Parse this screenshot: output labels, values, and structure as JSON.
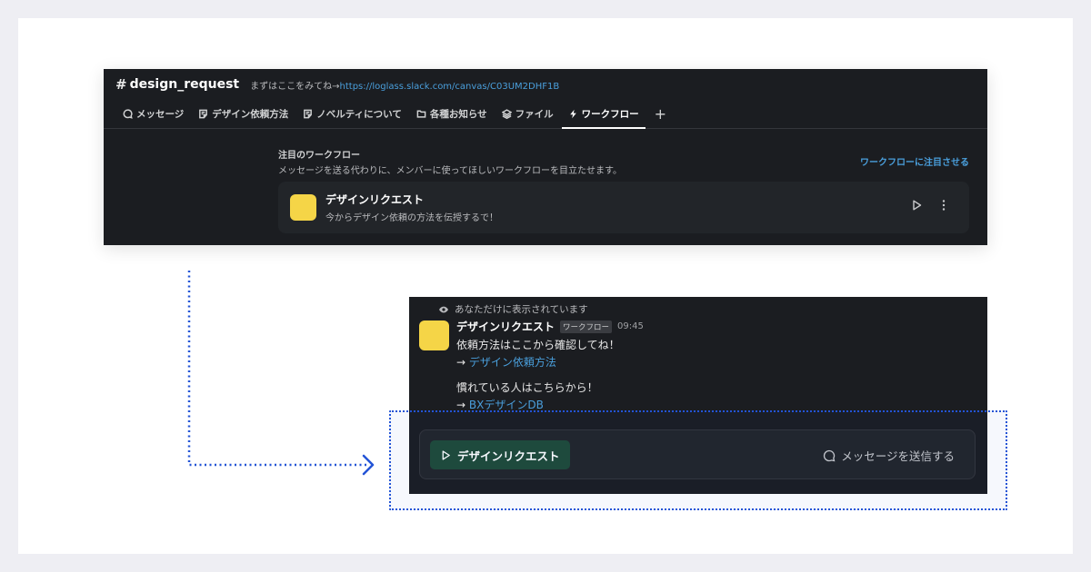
{
  "channel": {
    "hash": "#",
    "name": "design_request",
    "topic_text": "まずはここをみてね→",
    "topic_link": "https://loglass.slack.com/canvas/C03UM2DHF1B"
  },
  "tabs": [
    {
      "label": "メッセージ",
      "icon": "chat-bubble-icon"
    },
    {
      "label": "デザイン依頼方法",
      "icon": "canvas-icon"
    },
    {
      "label": "ノベルティについて",
      "icon": "canvas-icon"
    },
    {
      "label": "各種お知らせ",
      "icon": "folder-icon"
    },
    {
      "label": "ファイル",
      "icon": "layers-icon"
    },
    {
      "label": "ワークフロー",
      "icon": "lightning-icon",
      "active": true
    }
  ],
  "tab_add": "+",
  "featured": {
    "title": "注目のワークフロー",
    "description": "メッセージを送る代わりに、メンバーに使ってほしいワークフローを目立たせます。",
    "action": "ワークフローに注目させる"
  },
  "workflow_card": {
    "name": "デザインリクエスト",
    "subtitle": "今からデザイン依頼の方法を伝授するで！"
  },
  "message": {
    "ephemeral_note": "あなただけに表示されています",
    "author": "デザインリクエスト",
    "badge": "ワークフロー",
    "time": "09:45",
    "line1": "依頼方法はここから確認してね！",
    "arrow1": "→ ",
    "link1": "デザイン依頼方法",
    "line2": "慣れている人はこちらから！",
    "arrow2": "→ ",
    "link2": "BXデザインDB"
  },
  "action_bar": {
    "run_label": "デザインリクエスト",
    "send_label": "メッセージを送信する"
  },
  "colors": {
    "panel_bg": "#1b1d21",
    "link": "#4a9fdc",
    "avatar_yellow": "#f5d547",
    "run_button": "#1f4a38",
    "annotation_blue": "#2354d6"
  }
}
